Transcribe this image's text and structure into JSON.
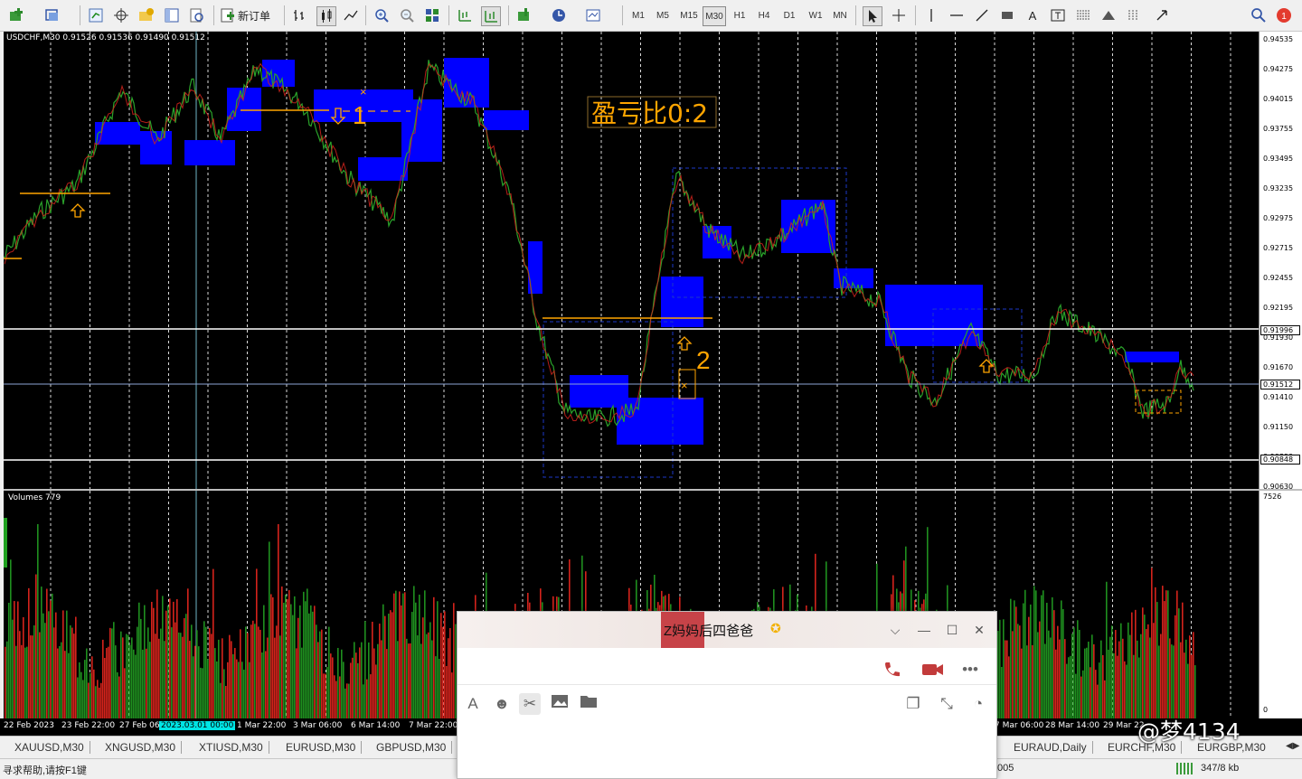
{
  "toolbar": {
    "new_order_label": "新订单",
    "timeframes": [
      "M1",
      "M5",
      "M15",
      "M30",
      "H1",
      "H4",
      "D1",
      "W1",
      "MN"
    ],
    "active_timeframe": "M30",
    "alert_badge": "1"
  },
  "chart": {
    "legend": "USDCHF,M30  0.91526 0.91536 0.91490 0.91512",
    "rr_label": "盈亏比0:2",
    "label_1": "1",
    "label_2": "2",
    "price_levels": [
      "0.94535",
      "0.94275",
      "0.94015",
      "0.93755",
      "0.93495",
      "0.93235",
      "0.92975",
      "0.92715",
      "0.92455",
      "0.92195",
      "0.91930",
      "0.91670",
      "0.91410",
      "0.91150",
      "0.90890",
      "0.90630"
    ],
    "highlight_prices": {
      "upper_line": "0.91996",
      "current": "0.91512",
      "lower_line": "0.90848"
    },
    "colors": {
      "background": "#000000",
      "zone": "#0000ff",
      "up_candle": "#1f9d1f",
      "down_candle": "#d01010",
      "level_line": "#ffa500",
      "white_line": "#ffffff"
    }
  },
  "volumes": {
    "legend": "Volumes 779",
    "scale_max": "7526",
    "scale_min": "0"
  },
  "time_labels": [
    "22 Feb 2023",
    "23 Feb 22:00",
    "27 Feb 06:00",
    "2023.03.01 00:00",
    "1 Mar 22:00",
    "3 Mar 06:00",
    "6 Mar 14:00",
    "7 Mar 22:00",
    "7 Mar 06:00",
    "28 Mar 14:00",
    "29 Mar 22"
  ],
  "time_highlight_index": 3,
  "symbol_tabs": [
    "XAUUSD,M30",
    "XNGUSD,M30",
    "XTIUSD,M30",
    "EURUSD,M30",
    "GBPUSD,M30",
    "EURAUD,Daily",
    "EURCHF,M30",
    "EURGBP,M30"
  ],
  "status": {
    "help": "寻求帮助,请按F1键",
    "partial": "005",
    "traffic": "347/8 kb"
  },
  "chat_window": {
    "title": "Z妈妈后四爸爸"
  },
  "watermark": "@梦4134"
}
